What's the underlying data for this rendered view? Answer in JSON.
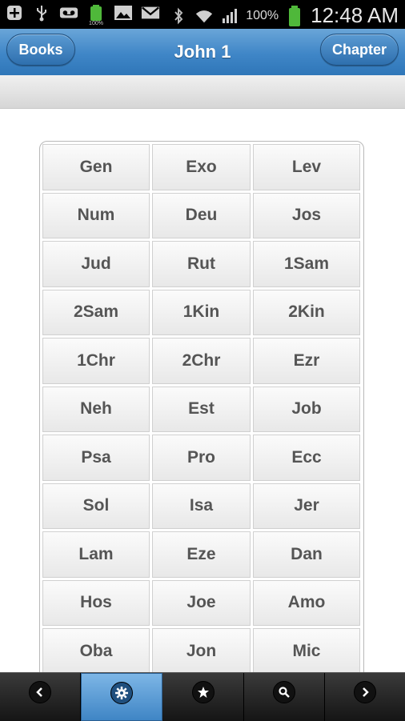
{
  "status_bar": {
    "battery_small": "100%",
    "battery_percent": "100%",
    "time": "12:48 AM"
  },
  "header": {
    "left_button": "Books",
    "title": "John 1",
    "right_button": "Chapter"
  },
  "books_grid": [
    [
      "Gen",
      "Exo",
      "Lev"
    ],
    [
      "Num",
      "Deu",
      "Jos"
    ],
    [
      "Jud",
      "Rut",
      "1Sam"
    ],
    [
      "2Sam",
      "1Kin",
      "2Kin"
    ],
    [
      "1Chr",
      "2Chr",
      "Ezr"
    ],
    [
      "Neh",
      "Est",
      "Job"
    ],
    [
      "Psa",
      "Pro",
      "Ecc"
    ],
    [
      "Sol",
      "Isa",
      "Jer"
    ],
    [
      "Lam",
      "Eze",
      "Dan"
    ],
    [
      "Hos",
      "Joe",
      "Amo"
    ],
    [
      "Oba",
      "Jon",
      "Mic"
    ]
  ],
  "tabbar": {
    "tabs": [
      {
        "icon": "chevron-left-icon"
      },
      {
        "icon": "gear-icon",
        "active": true
      },
      {
        "icon": "star-icon"
      },
      {
        "icon": "search-icon"
      },
      {
        "icon": "chevron-right-icon"
      }
    ]
  }
}
